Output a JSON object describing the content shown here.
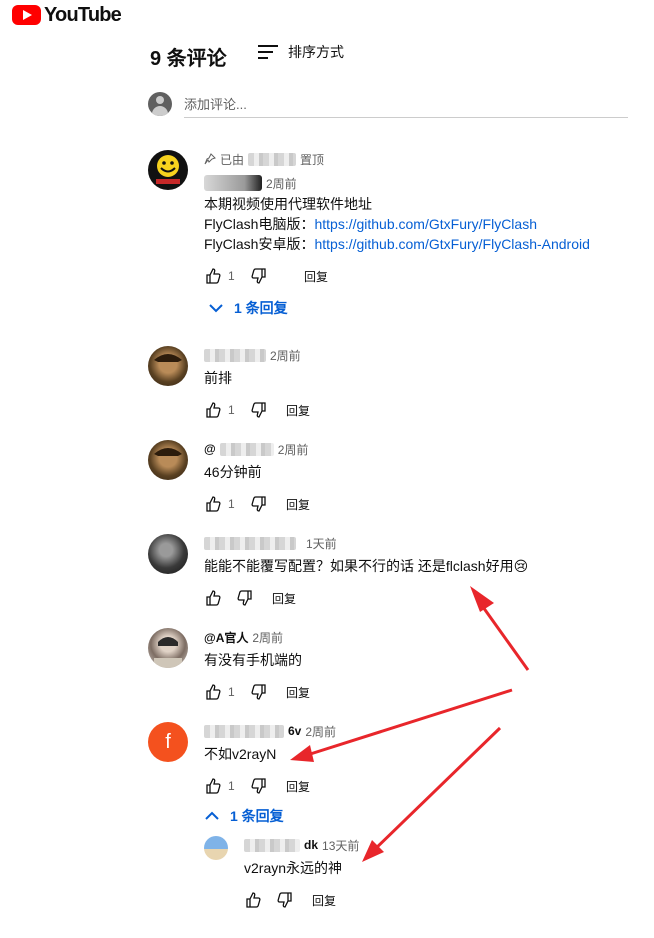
{
  "brand": {
    "name": "YouTube"
  },
  "header": {
    "count": "9 条评论",
    "sort_label": "排序方式"
  },
  "add_comment": {
    "placeholder": "添加评论..."
  },
  "comments": [
    {
      "pinned_prefix": "已由",
      "pinned_suffix": "置顶",
      "time": "2周前",
      "lines": [
        "本期视频使用代理软件地址"
      ],
      "links": [
        {
          "prefix": "FlyClash电脑版：",
          "url": "https://github.com/GtxFury/FlyClash"
        },
        {
          "prefix": "FlyClash安卓版：",
          "url": "https://github.com/GtxFury/FlyClash-Android"
        }
      ],
      "likes": "1",
      "reply_label": "回复",
      "replies_label": "1 条回复"
    },
    {
      "time": "2周前",
      "text": "前排",
      "likes": "1",
      "reply_label": "回复"
    },
    {
      "name_visible": "@",
      "time": "2周前",
      "text": "46分钟前",
      "likes": "1",
      "reply_label": "回复"
    },
    {
      "time": "1天前",
      "text": "能能不能覆写配置？如果不行的话 还是flclash好用😢",
      "likes": "",
      "reply_label": "回复"
    },
    {
      "name": "@A官人",
      "time": "2周前",
      "text": "有没有手机端的",
      "likes": "1",
      "reply_label": "回复"
    },
    {
      "name_tail": "6v",
      "avatar_letter": "f",
      "time": "2周前",
      "text": "不如v2rayN",
      "likes": "1",
      "reply_label": "回复",
      "replies_label": "1 条回复"
    },
    {
      "name_tail": "dk",
      "time": "13天前",
      "text": "v2rayn永远的神",
      "likes": "",
      "reply_label": "回复"
    }
  ],
  "colors": {
    "accent": "#065fd4",
    "brand": "#ff0000",
    "annotation": "#e8262b",
    "avatar_f": "#f4511e"
  }
}
